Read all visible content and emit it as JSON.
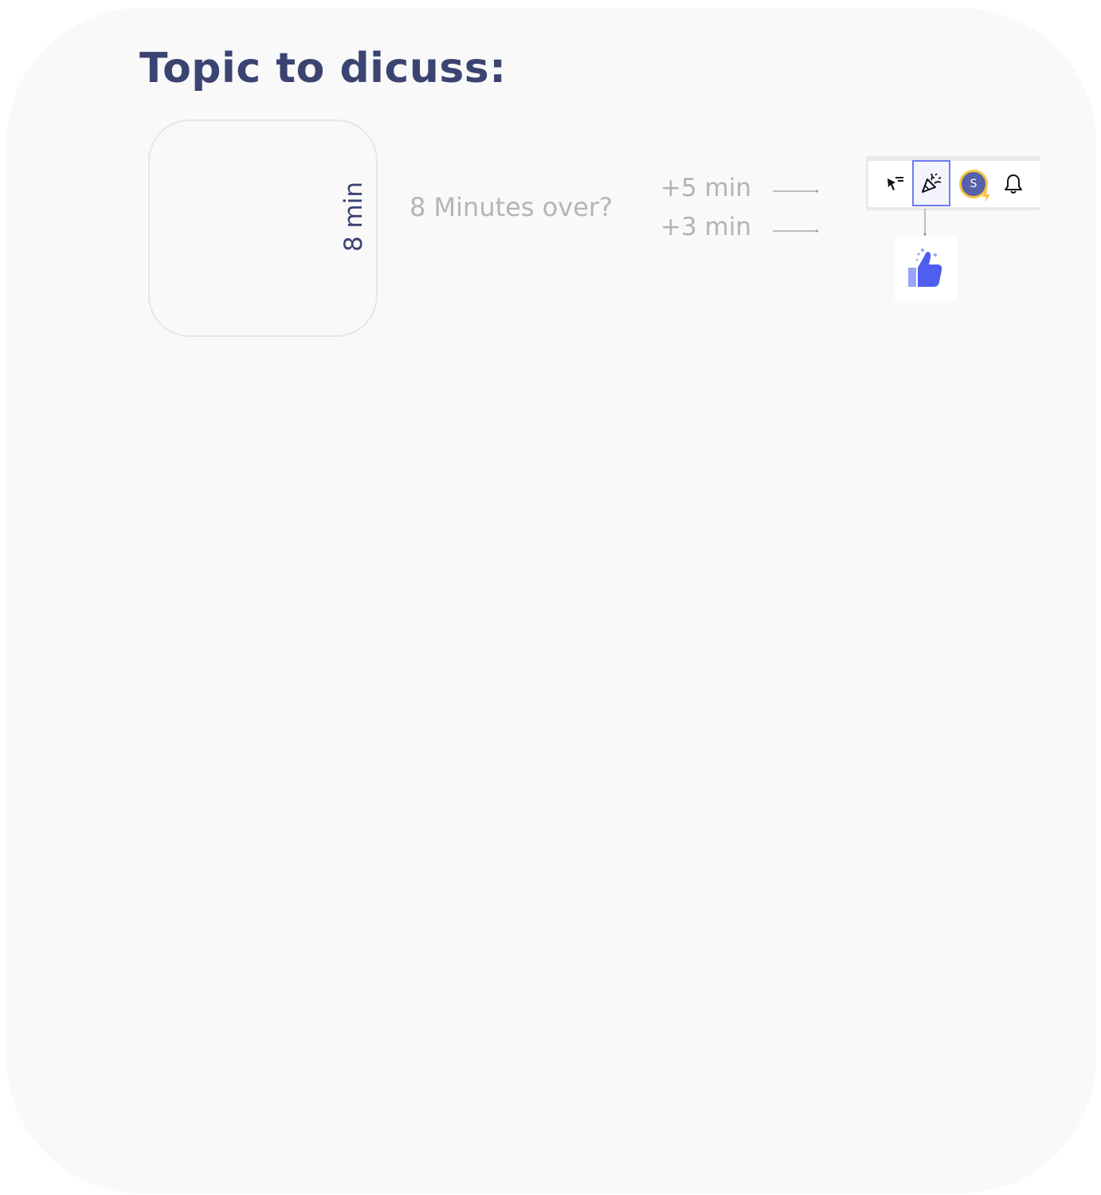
{
  "board": {
    "title": "Topic to dicuss:",
    "timer": {
      "label": "8 min"
    },
    "question": "8 Minutes over?",
    "options": [
      {
        "label": "+5 min"
      },
      {
        "label": "+3 min"
      }
    ]
  },
  "toolbar": {
    "items": [
      {
        "icon": "cursor-select-icon"
      },
      {
        "icon": "celebration-icon",
        "selected": true
      },
      {
        "icon": "avatar",
        "initial": "S"
      },
      {
        "icon": "bell-icon"
      }
    ]
  },
  "reaction": {
    "icon": "thumbs-up-icon"
  },
  "colors": {
    "title": "#3b4471",
    "muted_text": "#b5b5b5",
    "accent": "#6f7cf0",
    "avatar_bg": "#5561a8",
    "avatar_ring": "#f5c242",
    "thumb": "#4d5ef0"
  }
}
